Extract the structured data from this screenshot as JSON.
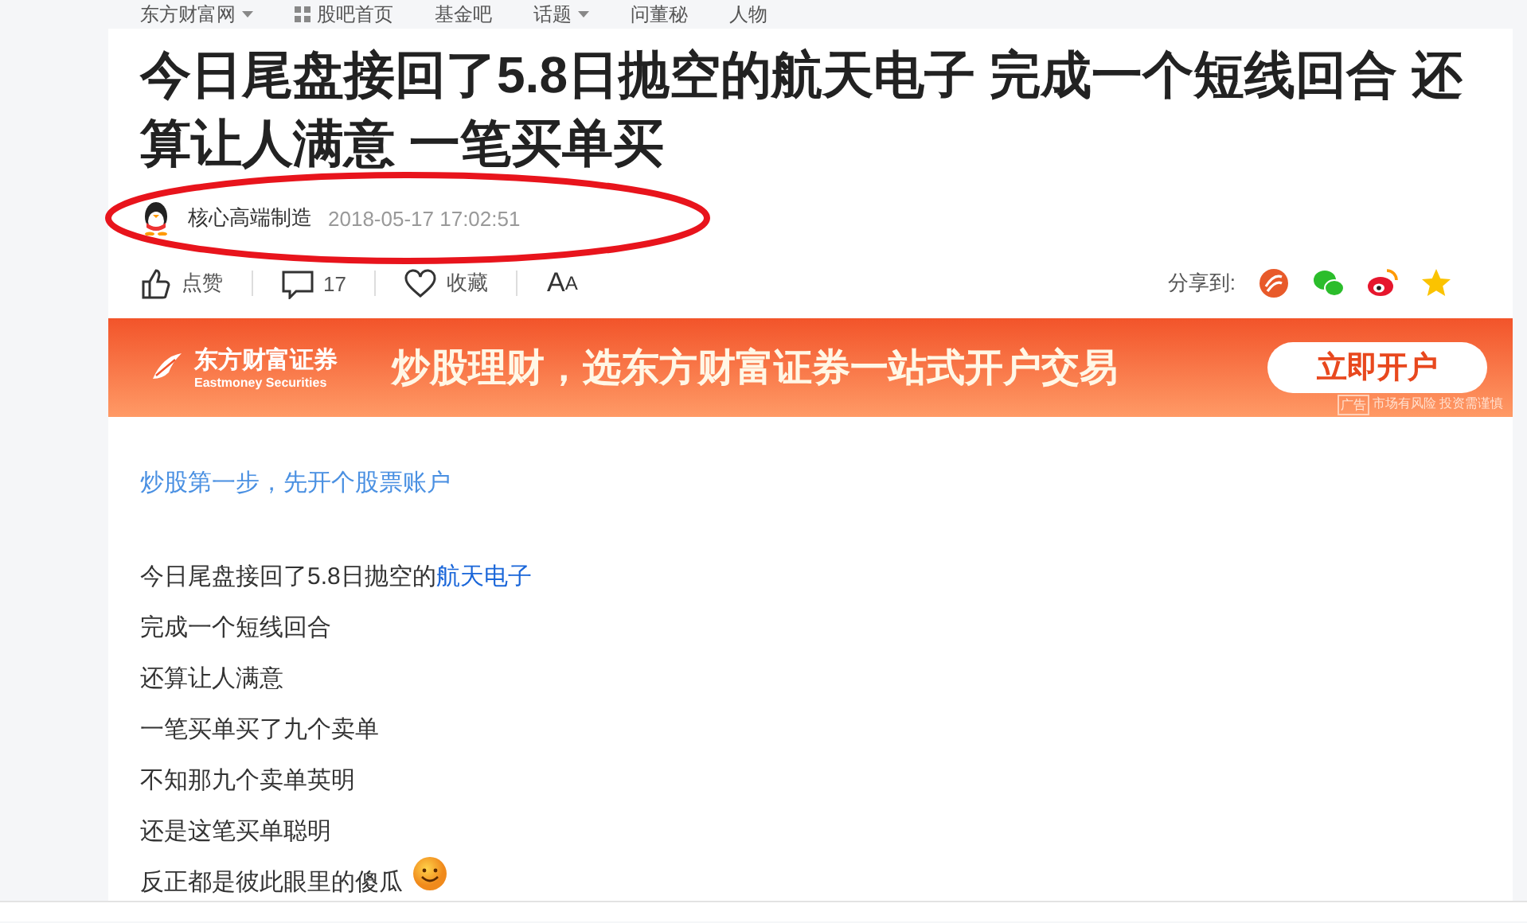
{
  "top_nav": [
    {
      "kind": "menu",
      "label": "东方财富网"
    },
    {
      "kind": "home",
      "label": "股吧首页"
    },
    {
      "kind": "link",
      "label": "基金吧"
    },
    {
      "kind": "menu",
      "label": "话题"
    },
    {
      "kind": "link",
      "label": "问董秘"
    },
    {
      "kind": "link",
      "label": "人物"
    }
  ],
  "article": {
    "title": "今日尾盘接回了5.8日抛空的航天电子 完成一个短线回合 还算让人满意 一笔买单买",
    "author": "核心高端制造",
    "time": "2018-05-17 17:02:51",
    "actions": [
      {
        "kind": "like",
        "label": "点赞"
      },
      {
        "kind": "comment",
        "label": "17"
      },
      {
        "kind": "favorite",
        "label": "收藏"
      },
      {
        "kind": "font",
        "label": "A",
        "label_small": "A"
      }
    ],
    "share": {
      "label": "分享到:"
    }
  },
  "banner": {
    "brand": "东方财富证券",
    "brand_en": "Eastmoney Securities",
    "slogan": "炒股理财，选东方财富证券一站式开户交易",
    "button": "立即开户",
    "ad_tag": "广告",
    "disclaimer": "市场有风险 投资需谨慎"
  },
  "body": {
    "promo_link": "炒股第一步，先开个股票账户",
    "paragraphs": [
      {
        "text": "今日尾盘接回了5.8日抛空的",
        "link": "航天电子",
        "emoji": false
      },
      {
        "text": "完成一个短线回合",
        "emoji": false
      },
      {
        "text": "还算让人满意",
        "emoji": false
      },
      {
        "text": "一笔买单买了九个卖单",
        "emoji": false
      },
      {
        "text": "不知那九个卖单英明",
        "emoji": false
      },
      {
        "text": "还是这笔买单聪明",
        "emoji": false
      },
      {
        "text": "反正都是彼此眼里的傻瓜",
        "emoji": true
      }
    ]
  }
}
